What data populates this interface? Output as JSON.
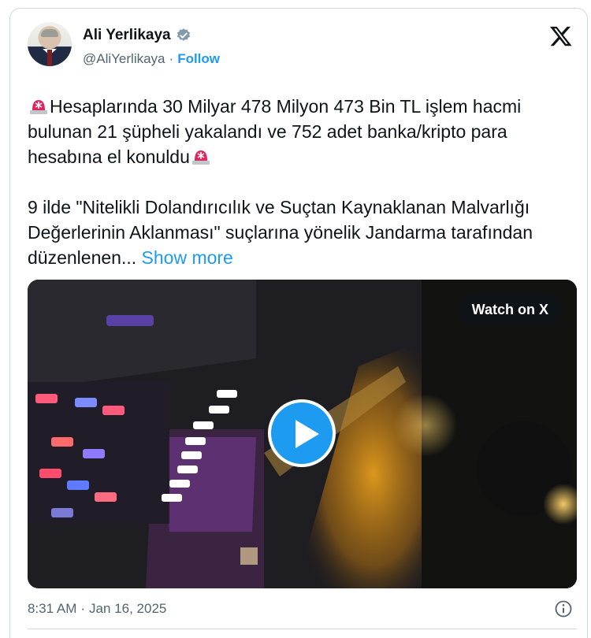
{
  "author": {
    "name": "Ali Yerlikaya",
    "handle": "@AliYerlikaya",
    "dot": "·",
    "follow_label": "Follow"
  },
  "tweet": {
    "paragraph1": "Hesaplarında 30 Milyar 478 Milyon 473 Bin TL işlem hacmi bulunan 21 şüpheli yakalandı ve 752 adet banka/kripto para hesabına el konuldu",
    "paragraph2": "9 ilde \"Nitelikli Dolandırıcılık ve Suçtan Kaynaklanan Malvarlığı Değerlerinin Aklanması\" suçlarına yönelik Jandarma tarafından düzenlenen...",
    "show_more_label": "Show more"
  },
  "media": {
    "watch_label": "Watch on X"
  },
  "meta": {
    "time": "8:31 AM",
    "dot": "·",
    "date": "Jan 16, 2025"
  },
  "colors": {
    "accent": "#1d9bf0",
    "secondary_text": "#536471",
    "siren_red": "#e0245e"
  },
  "icons": [
    "verified-badge-icon",
    "x-logo-icon",
    "siren-emoji-icon",
    "play-icon",
    "info-icon"
  ]
}
